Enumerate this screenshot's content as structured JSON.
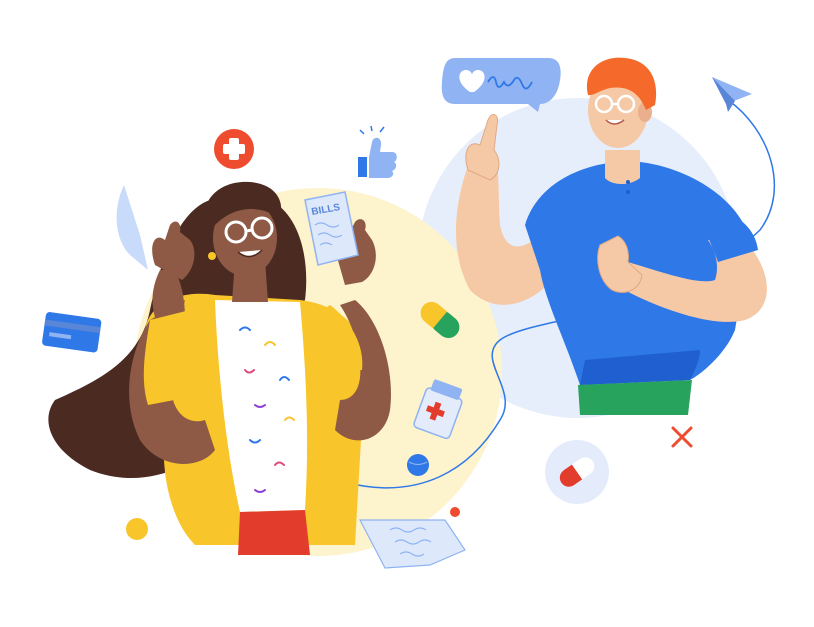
{
  "illustration": {
    "bills_label": "BILLS",
    "colors": {
      "background": "#ffffff",
      "left_circle": "#fdf4cf",
      "right_circle": "#e4ecfb",
      "accent_blue": "#2f78e8",
      "light_blue": "#8fb3f3",
      "red_orange": "#ef4b2f",
      "yellow": "#f8c52a",
      "green": "#28a35e",
      "dark_skin": "#8e5a45",
      "hair_dark": "#4b2a22",
      "light_skin": "#f6c9a6",
      "hair_orange": "#f56a2a"
    },
    "icons": [
      "plus-badge-icon",
      "thumbs-up-icon",
      "heart-message-icon",
      "paper-plane-icon",
      "pill-capsule-icon",
      "medicine-bottle-icon",
      "credit-card-icon",
      "receipt-icon",
      "x-mark-icon"
    ]
  }
}
